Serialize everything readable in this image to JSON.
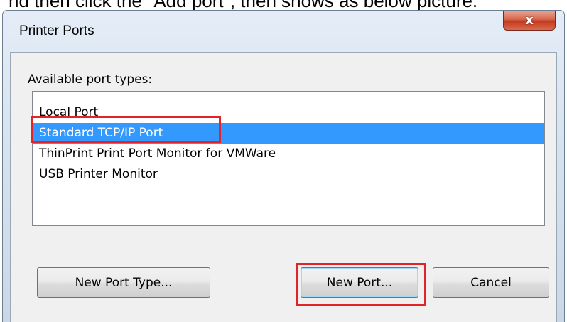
{
  "caption": "nd then click the \"Add port\", then shows as below picture.",
  "window": {
    "title": "Printer Ports",
    "close_glyph": "x"
  },
  "port_types": {
    "label": "Available port types:",
    "items": [
      {
        "label": "Local Port",
        "selected": false
      },
      {
        "label": "Standard TCP/IP Port",
        "selected": true
      },
      {
        "label": "ThinPrint Print Port Monitor for VMWare",
        "selected": false
      },
      {
        "label": "USB Printer Monitor",
        "selected": false
      }
    ]
  },
  "buttons": {
    "new_port_type": "New Port Type...",
    "new_port": "New Port...",
    "cancel": "Cancel"
  },
  "colors": {
    "selection": "#3399ff",
    "highlight_box": "#e0242a"
  }
}
